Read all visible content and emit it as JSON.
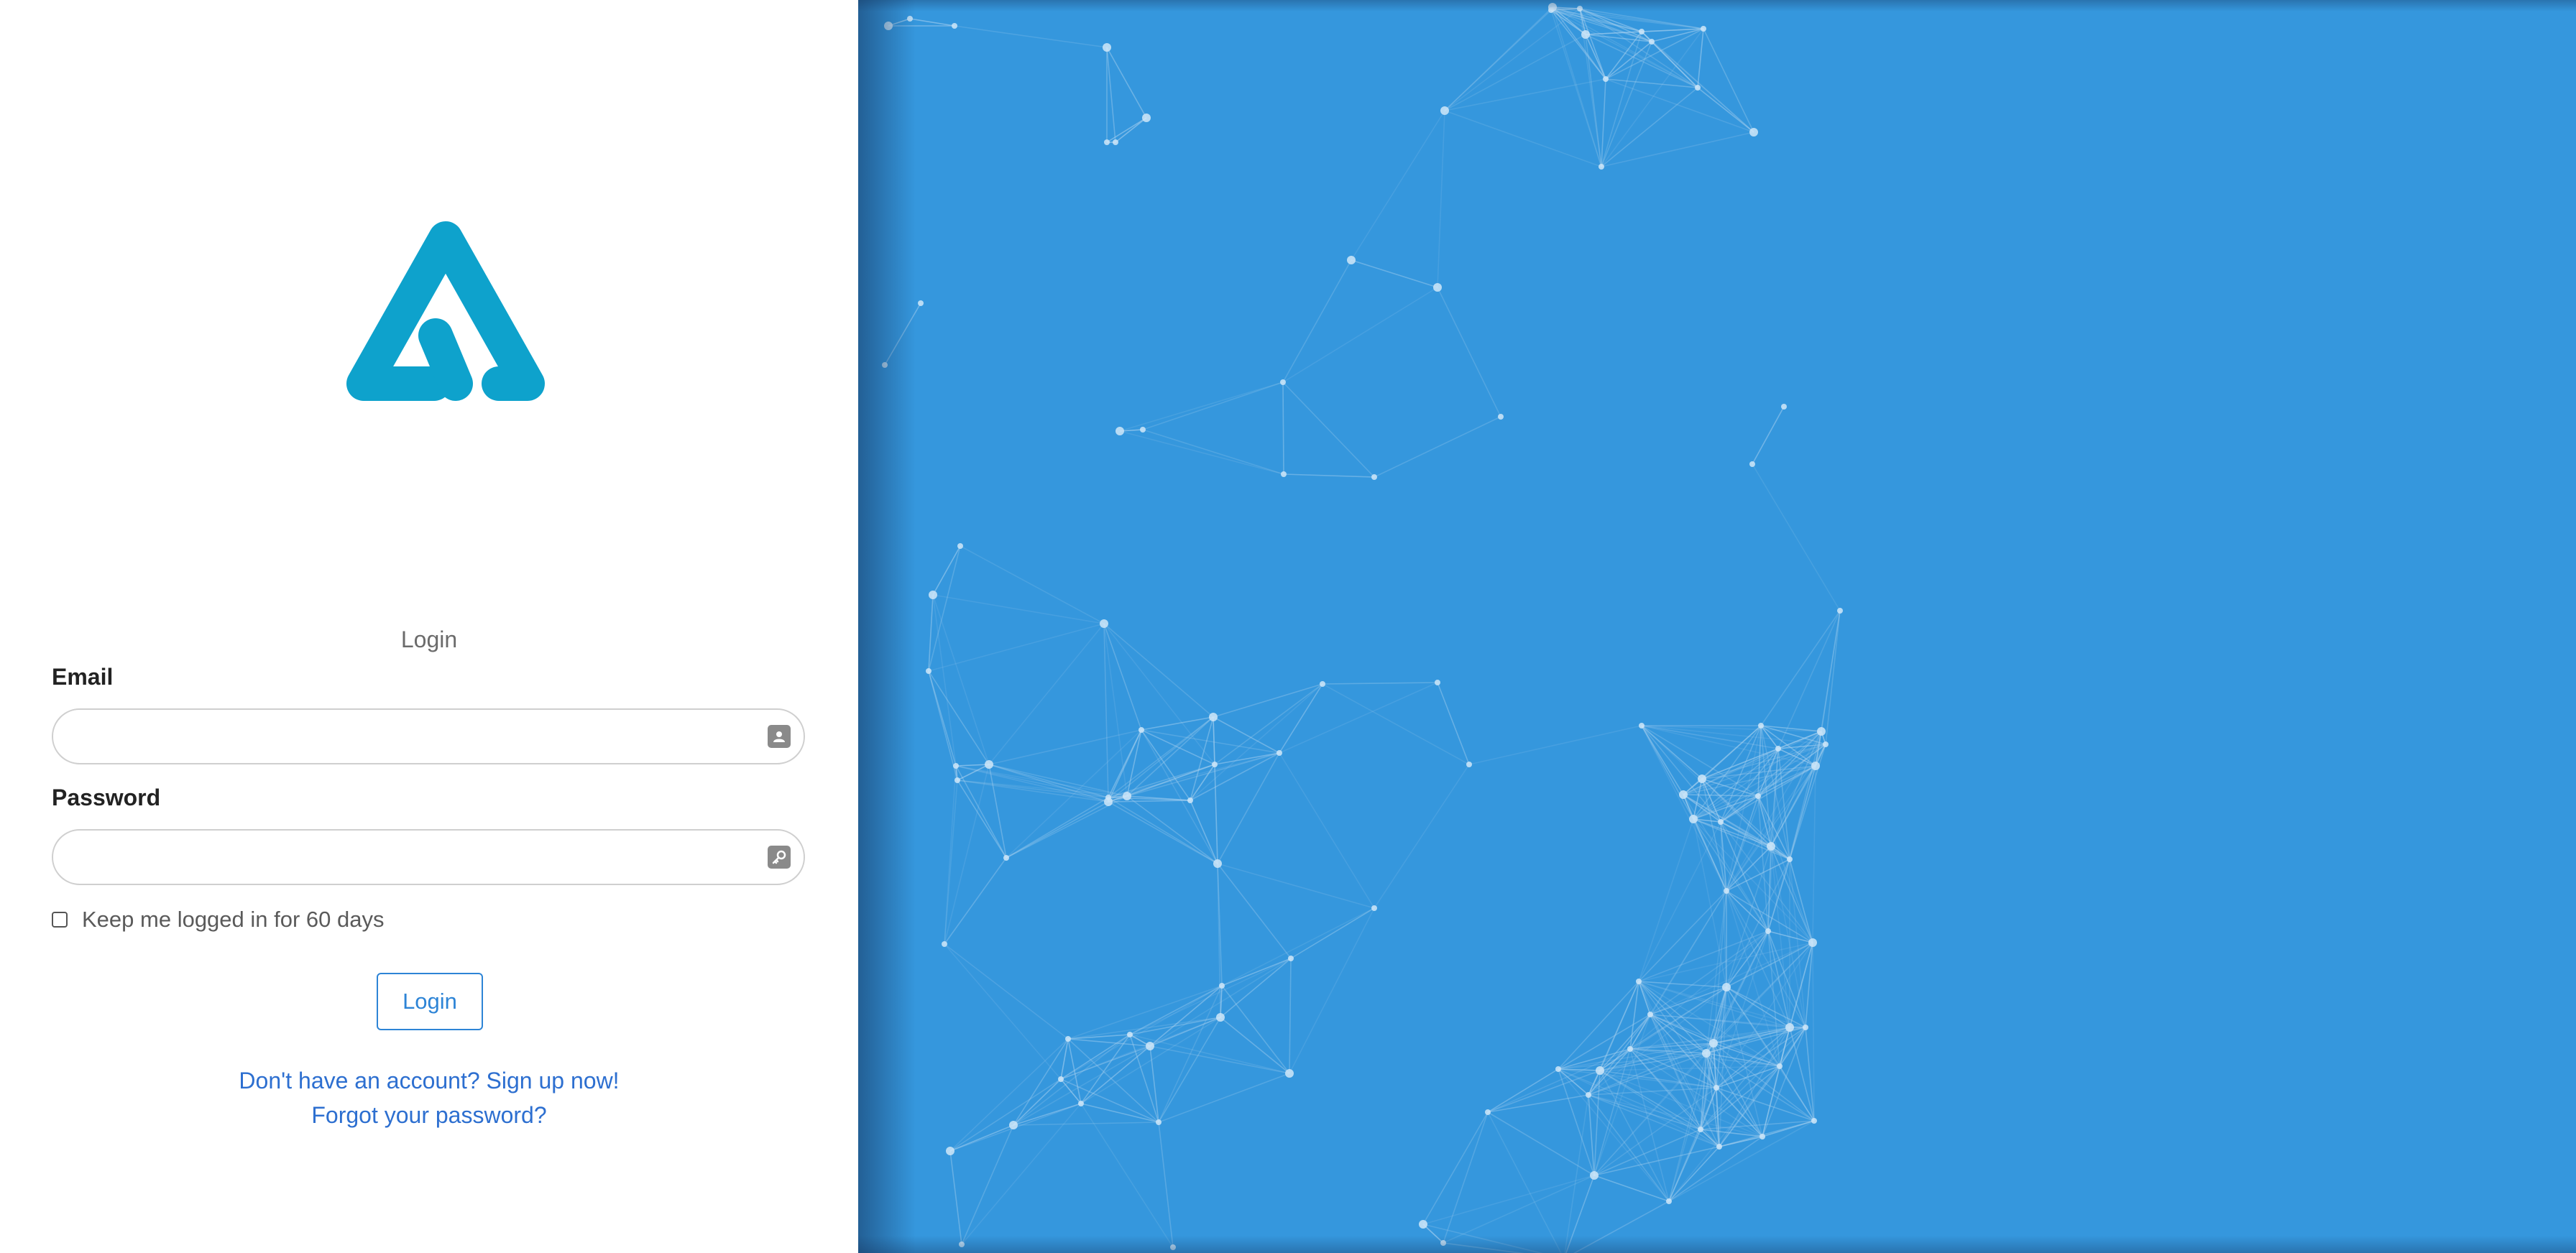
{
  "colors": {
    "brand_logo": "#0ea2cc",
    "accent": "#2d84d6",
    "link": "#2d6fd0",
    "background_panel": "#3597dd",
    "network_line": "#a7d0ef",
    "network_node": "#cfe6f8"
  },
  "brand": {
    "logo_icon": "brand-logo-icon"
  },
  "form": {
    "title": "Login",
    "email": {
      "label": "Email",
      "value": "",
      "placeholder": "",
      "icon": "address-card-icon"
    },
    "password": {
      "label": "Password",
      "value": "",
      "placeholder": "",
      "icon": "key-icon"
    },
    "remember": {
      "label": "Keep me logged in for 60 days",
      "checked": false
    },
    "submit_label": "Login"
  },
  "links": {
    "signup": "Don't have an account? Sign up now!",
    "forgot": "Forgot your password?"
  }
}
